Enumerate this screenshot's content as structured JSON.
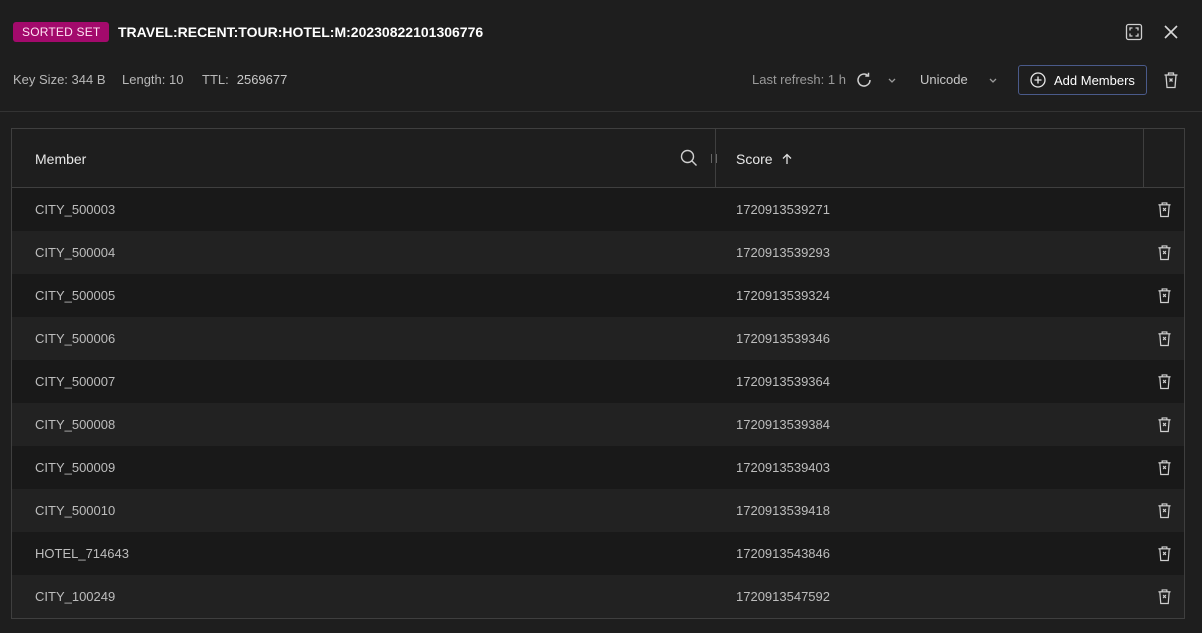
{
  "header": {
    "type_badge": "SORTED SET",
    "key_name": "TRAVEL:RECENT:TOUR:HOTEL:M:20230822101306776",
    "key_size": "Key Size: 344 B",
    "length": "Length: 10",
    "ttl_label": "TTL:",
    "ttl_value": "2569677",
    "last_refresh": "Last refresh: 1 h",
    "encoding": "Unicode",
    "add_members_label": "Add Members",
    "icons": {
      "fullscreen": "fullscreen-icon",
      "close": "close-icon",
      "refresh": "refresh-icon",
      "chevron": "chevron-down-icon",
      "add": "plus-circle-icon",
      "delete": "trash-icon"
    }
  },
  "table": {
    "columns": {
      "member": "Member",
      "score": "Score"
    },
    "sort": {
      "column": "score",
      "direction": "ascending"
    },
    "rows": [
      {
        "member": "CITY_500003",
        "score": "1720913539271"
      },
      {
        "member": "CITY_500004",
        "score": "1720913539293"
      },
      {
        "member": "CITY_500005",
        "score": "1720913539324"
      },
      {
        "member": "CITY_500006",
        "score": "1720913539346"
      },
      {
        "member": "CITY_500007",
        "score": "1720913539364"
      },
      {
        "member": "CITY_500008",
        "score": "1720913539384"
      },
      {
        "member": "CITY_500009",
        "score": "1720913539403"
      },
      {
        "member": "CITY_500010",
        "score": "1720913539418"
      },
      {
        "member": "HOTEL_714643",
        "score": "1720913543846"
      },
      {
        "member": "CITY_100249",
        "score": "1720913547592"
      }
    ]
  },
  "colors": {
    "background": "#1e1e1e",
    "badge": "#a30a6c",
    "button_border": "#4a5a8a"
  }
}
